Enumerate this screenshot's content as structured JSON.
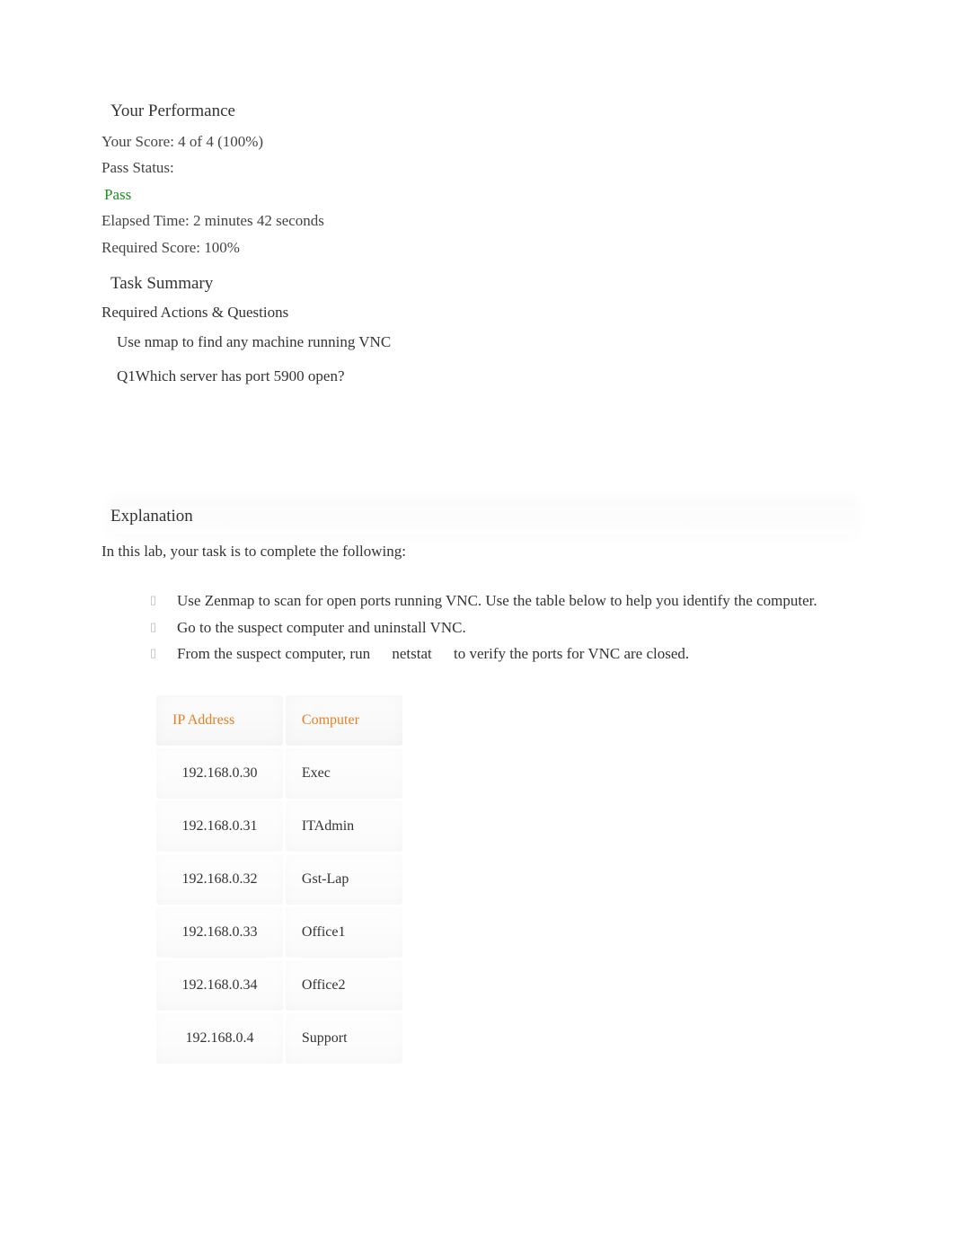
{
  "performance": {
    "heading": "Your Performance",
    "score_line": "Your Score: 4 of 4 (100%)",
    "pass_status_label": "Pass Status:",
    "pass_status_value": "Pass",
    "elapsed_time": "Elapsed Time: 2 minutes 42 seconds",
    "required_score": "Required Score: 100%"
  },
  "task_summary": {
    "heading": "Task Summary",
    "subheading": "Required Actions & Questions",
    "items": [
      "Use nmap to find any machine running VNC",
      "Q1Which server has port 5900 open?"
    ]
  },
  "explanation": {
    "heading": "Explanation",
    "intro": "In this lab, your task is to complete the following:",
    "bullets": [
      {
        "pre": "Use Zenmap to scan for open ports running VNC. Use the table below to help you identify the computer.",
        "mid": "",
        "post": ""
      },
      {
        "pre": "Go to the suspect computer and uninstall VNC.",
        "mid": "",
        "post": ""
      },
      {
        "pre": "From the suspect computer, run",
        "mid": "netstat",
        "post": "to verify the ports for VNC are closed."
      }
    ],
    "table": {
      "headers": [
        "IP Address",
        "Computer"
      ],
      "rows": [
        {
          "ip": "192.168.0.30",
          "computer": "Exec"
        },
        {
          "ip": "192.168.0.31",
          "computer": "ITAdmin"
        },
        {
          "ip": "192.168.0.32",
          "computer": "Gst-Lap"
        },
        {
          "ip": "192.168.0.33",
          "computer": "Office1"
        },
        {
          "ip": "192.168.0.34",
          "computer": "Office2"
        },
        {
          "ip": "192.168.0.4",
          "computer": "Support"
        }
      ]
    }
  }
}
